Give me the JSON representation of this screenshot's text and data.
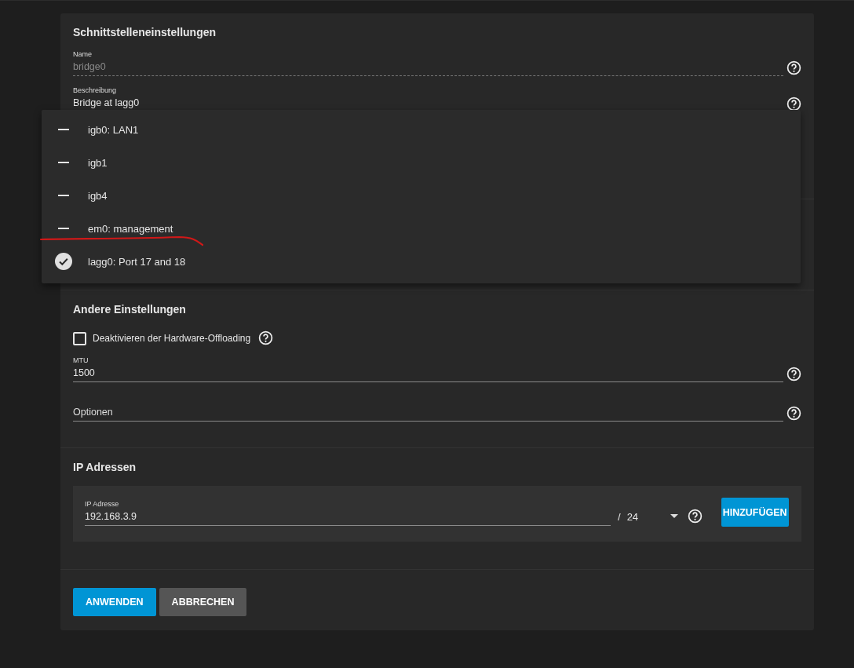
{
  "interface_settings": {
    "title": "Schnittstelleneinstellungen",
    "name_field": {
      "label": "Name",
      "value": "bridge0",
      "disabled": true
    },
    "description_field": {
      "label": "Beschreibung",
      "value": "Bridge at lagg0"
    }
  },
  "member_dropdown": {
    "options": [
      {
        "label": "igb0: LAN1",
        "selected": false
      },
      {
        "label": "igb1",
        "selected": false
      },
      {
        "label": "igb4",
        "selected": false
      },
      {
        "label": "em0: management",
        "selected": false
      },
      {
        "label": "lagg0: Port 17 and 18",
        "selected": true
      }
    ]
  },
  "other_settings": {
    "title": "Andere Einstellungen",
    "offloading_checkbox": {
      "label": "Deaktivieren der Hardware-Offloading",
      "checked": false
    },
    "mtu_field": {
      "label": "MTU",
      "value": "1500"
    },
    "options_field": {
      "placeholder": "Optionen"
    }
  },
  "ip_addresses": {
    "title": "IP Adressen",
    "address_field": {
      "label": "IP Adresse",
      "value": "192.168.3.9"
    },
    "separator": "/",
    "netmask": "24",
    "add_button": "HINZUFÜGEN"
  },
  "buttons": [
    {
      "label": "ANWENDEN",
      "kind": "primary"
    },
    {
      "label": "ABBRECHEN",
      "kind": "secondary"
    }
  ]
}
